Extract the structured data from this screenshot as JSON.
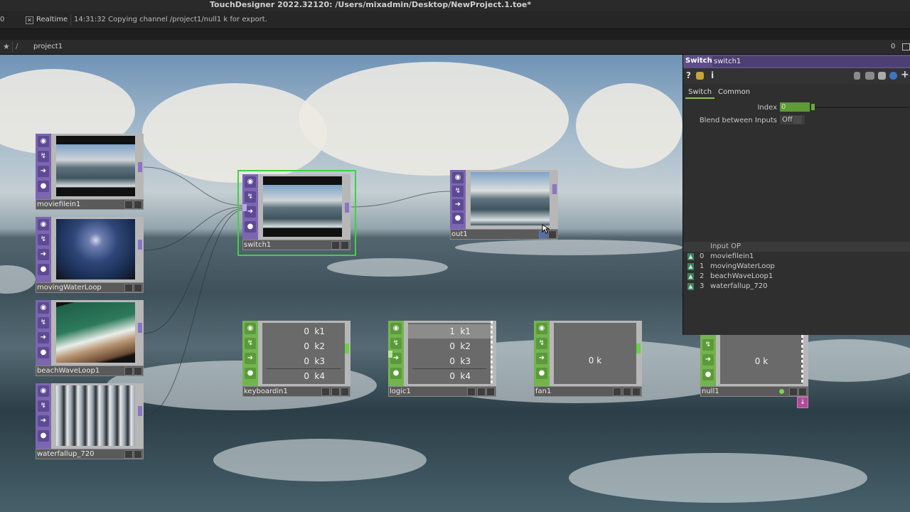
{
  "window": {
    "title": "TouchDesigner 2022.32120: /Users/mixadmin/Desktop/NewProject.1.toe*"
  },
  "status": {
    "frame_fragment": "0",
    "realtime_box": "✕",
    "realtime_label": "Realtime",
    "message": "14:31:32 Copying channel /project1/null1 k for export."
  },
  "pathbar": {
    "star": "★",
    "slash": "/",
    "crumb": "project1",
    "count": "0"
  },
  "nodes": {
    "moviefilein1": {
      "name": "moviefilein1"
    },
    "movingWaterLoop": {
      "name": "movingWaterLoop"
    },
    "beachWaveLoop1": {
      "name": "beachWaveLoop1"
    },
    "waterfallup_720": {
      "name": "waterfallup_720"
    },
    "switch1": {
      "name": "switch1"
    },
    "out1": {
      "name": "out1"
    },
    "keyboardin1": {
      "name": "keyboardin1",
      "channels": [
        {
          "value": "0",
          "name": "k1"
        },
        {
          "value": "0",
          "name": "k2"
        },
        {
          "value": "0",
          "name": "k3"
        },
        {
          "value": "0",
          "name": "k4"
        }
      ]
    },
    "logic1": {
      "name": "logic1",
      "channels": [
        {
          "value": "1",
          "name": "k1"
        },
        {
          "value": "0",
          "name": "k2"
        },
        {
          "value": "0",
          "name": "k3"
        },
        {
          "value": "0",
          "name": "k4"
        }
      ]
    },
    "fan1": {
      "name": "fan1",
      "display": "0 k"
    },
    "null1": {
      "name": "null1",
      "display": "0 k"
    }
  },
  "flag_icons": [
    "viewer-icon",
    "bypass-icon",
    "display-icon",
    "lock-icon"
  ],
  "panel": {
    "type": "Switch",
    "name": "switch1",
    "tool_help": "?",
    "tool_info": "i",
    "tool_plus": "+",
    "tabs": [
      "Switch",
      "Common"
    ],
    "params": {
      "index_label": "Index",
      "index_value": "0",
      "blend_label": "Blend between Inputs",
      "blend_value": "Off"
    },
    "inputs_header": "Input OP",
    "inputs": [
      {
        "num": "0",
        "op": "moviefilein1"
      },
      {
        "num": "1",
        "op": "movingWaterLoop"
      },
      {
        "num": "2",
        "op": "beachWaveLoop1"
      },
      {
        "num": "3",
        "op": "waterfallup_720"
      }
    ]
  },
  "colors": {
    "top_operator": "#7c66b0",
    "chop_operator": "#74b44f",
    "selection": "#3fd23f",
    "panel_header": "#5e4f8a"
  }
}
